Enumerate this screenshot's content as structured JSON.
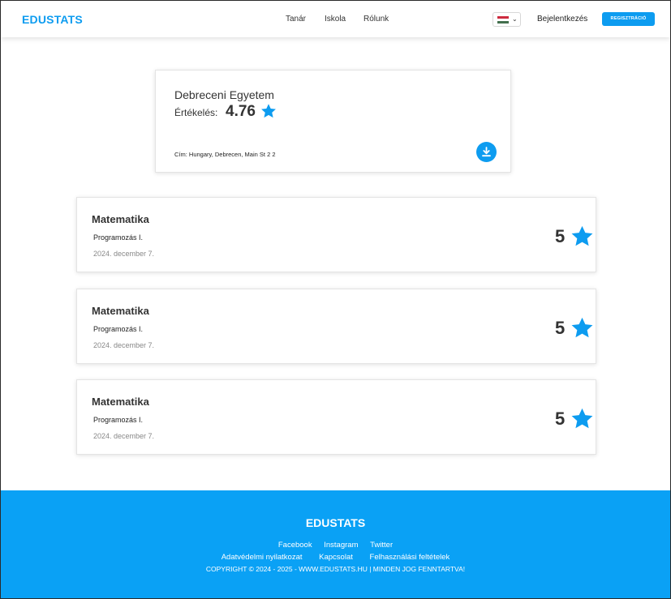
{
  "header": {
    "brand": "EDUSTATS",
    "nav": [
      "Tanár",
      "Iskola",
      "Rólunk"
    ],
    "language_flag": "hungary-flag",
    "login_label": "Bejelentkezés",
    "register_label": "REGISZTRÁCIÓ"
  },
  "school": {
    "name": "Debreceni Egyetem",
    "rating_label": "Értékelés:",
    "rating_value": "4.76",
    "address": "Cím: Hungary, Debrecen, Main St 2 2",
    "download_icon": "download-icon"
  },
  "reviews": [
    {
      "subject": "Matematika",
      "course": "Programozás I.",
      "date": "2024. december 7.",
      "score": "5"
    },
    {
      "subject": "Matematika",
      "course": "Programozás I.",
      "date": "2024. december 7.",
      "score": "5"
    },
    {
      "subject": "Matematika",
      "course": "Programozás I.",
      "date": "2024. december 7.",
      "score": "5"
    }
  ],
  "footer": {
    "brand": "EDUSTATS",
    "social": [
      "Facebook",
      "Instagram",
      "Twitter"
    ],
    "links": [
      "Adatvédelmi nyilatkozat",
      "Kapcsolat",
      "Felhasználási feltételek"
    ],
    "copyright": "COPYRIGHT © 2024 - 2025 - WWW.EDUSTATS.HU | MINDEN JOG FENNTARTVA!"
  },
  "colors": {
    "accent": "#0d9cf0",
    "footer_bg": "#0aa1f5",
    "star": "#0d9cf0"
  }
}
